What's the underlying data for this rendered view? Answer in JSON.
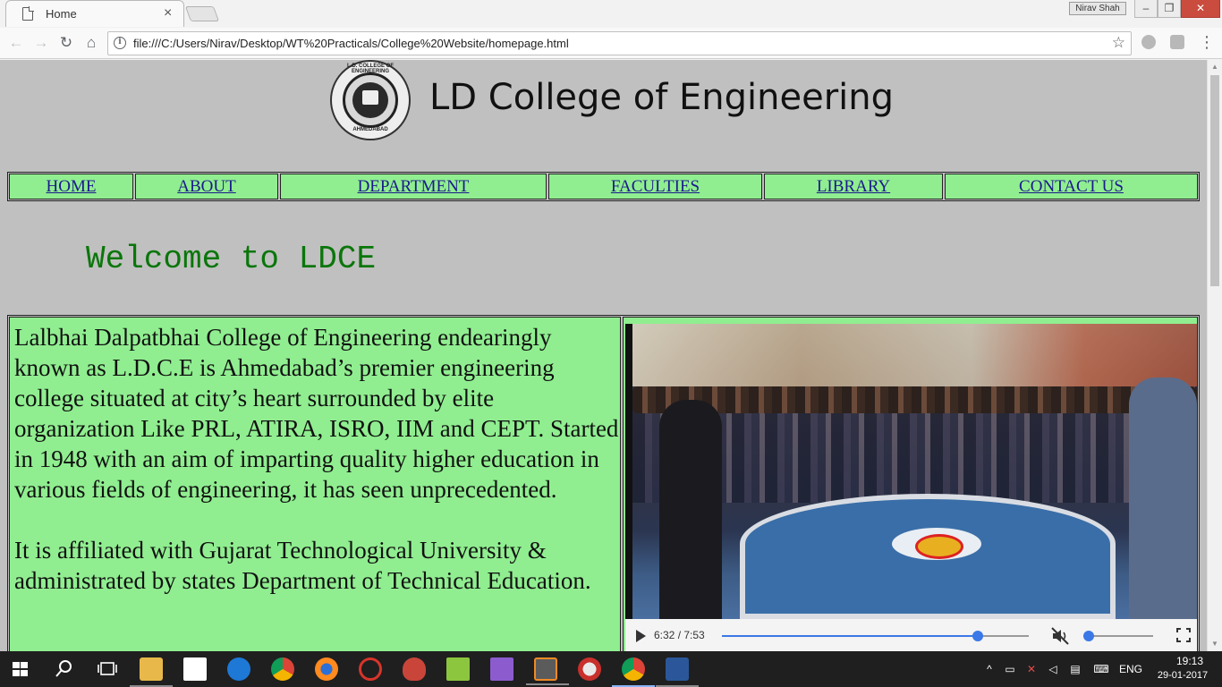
{
  "browser": {
    "tab": {
      "title": "Home",
      "close": "×"
    },
    "profile": "Nirav Shah",
    "window_controls": {
      "minimize": "–",
      "maximize": "❐",
      "close": "✕"
    },
    "nav": {
      "back": "←",
      "forward": "→",
      "reload": "↻",
      "home": "⌂"
    },
    "omnibox": {
      "info": "i",
      "url": "file:///C:/Users/Nirav/Desktop/WT%20Practicals/College%20Website/homepage.html",
      "star": "☆"
    },
    "menu": "⋮"
  },
  "page": {
    "logo": {
      "top_text": "L.D. COLLEGE OF ENGINEERING",
      "bottom_text": "AHMEDABAD"
    },
    "title": "LD College of Engineering",
    "nav": [
      {
        "label": "HOME"
      },
      {
        "label": "ABOUT"
      },
      {
        "label": "DEPARTMENT"
      },
      {
        "label": "FACULTIES"
      },
      {
        "label": "LIBRARY"
      },
      {
        "label": "CONTACT US"
      }
    ],
    "welcome": "Welcome to LDCE",
    "paragraphs": [
      "Lalbhai Dalpatbhai College of Engineering endearingly known as L.D.C.E is Ahmedabad’s premier engineering college situated at city’s heart surrounded by elite organization Like PRL, ATIRA, ISRO, IIM and CEPT. Started in 1948 with an aim of imparting quality higher education in various fields of engineering, it has seen unprecedented.",
      "It is affiliated with Gujarat Technological University & administrated by states Department of Technical Education."
    ],
    "video": {
      "time": "6:32 / 7:53",
      "progress_fraction": 0.833,
      "volume_fraction": 0,
      "muted": true
    }
  },
  "taskbar": {
    "apps": [
      "search",
      "task-view",
      "file-explorer",
      "store",
      "edge",
      "chrome",
      "firefox",
      "app-red",
      "app-cloud",
      "notepad-plus-plus",
      "visual-studio",
      "sublime-text",
      "paint",
      "chrome-active",
      "word"
    ],
    "tray": {
      "language": "ENG",
      "time": "19:13",
      "date": "29-01-2017"
    }
  },
  "colors": {
    "page_bg": "#c0c0c0",
    "cell_bg": "#90ee90",
    "welcome": "#0a760a",
    "link": "#1a1a8c",
    "accent": "#3b78e7"
  }
}
